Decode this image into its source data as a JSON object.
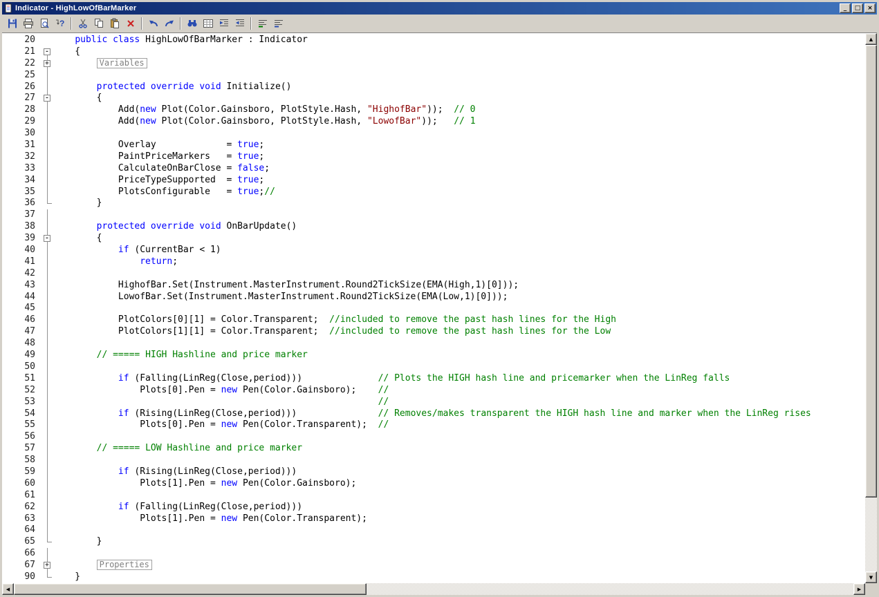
{
  "window": {
    "title": "Indicator - HighLowOfBarMarker",
    "titlebar_colors": [
      "#0a246a",
      "#3f74bd"
    ],
    "controls": {
      "minimize": "_",
      "maximize": "□",
      "close": "×"
    }
  },
  "toolbar": {
    "groups": [
      {
        "buttons": [
          {
            "name": "save"
          },
          {
            "name": "print"
          },
          {
            "name": "print-preview"
          },
          {
            "name": "context-help"
          }
        ]
      },
      {
        "buttons": [
          {
            "name": "cut"
          },
          {
            "name": "copy"
          },
          {
            "name": "paste"
          },
          {
            "name": "delete"
          }
        ]
      },
      {
        "buttons": [
          {
            "name": "undo"
          },
          {
            "name": "redo"
          }
        ]
      },
      {
        "buttons": [
          {
            "name": "find"
          },
          {
            "name": "goto-line"
          },
          {
            "name": "indent"
          },
          {
            "name": "outdent"
          }
        ]
      },
      {
        "buttons": [
          {
            "name": "comment"
          },
          {
            "name": "uncomment"
          }
        ]
      }
    ]
  },
  "editor": {
    "colors": {
      "keyword": "#0000ff",
      "comment": "#008000",
      "string": "#8b0000",
      "plain": "#000000",
      "region": "#808080",
      "line_number": "#202020"
    },
    "collapsed_regions": [
      "Variables",
      "Properties"
    ],
    "lines": [
      {
        "n": "20",
        "f": "",
        "s": [
          [
            "p",
            "    "
          ],
          [
            "k",
            "public"
          ],
          [
            "p",
            " "
          ],
          [
            "k",
            "class"
          ],
          [
            "p",
            " HighLowOfBarMarker : Indicator"
          ]
        ]
      },
      {
        "n": "21",
        "f": "open-first",
        "s": [
          [
            "p",
            "    {"
          ]
        ]
      },
      {
        "n": "22",
        "f": "closed",
        "s": [
          [
            "p",
            "        "
          ],
          [
            "g",
            "Variables"
          ]
        ]
      },
      {
        "n": "25",
        "f": "line",
        "s": []
      },
      {
        "n": "26",
        "f": "line",
        "s": [
          [
            "p",
            "        "
          ],
          [
            "k",
            "protected"
          ],
          [
            "p",
            " "
          ],
          [
            "k",
            "override"
          ],
          [
            "p",
            " "
          ],
          [
            "k",
            "void"
          ],
          [
            "p",
            " Initialize()"
          ]
        ]
      },
      {
        "n": "27",
        "f": "open",
        "s": [
          [
            "p",
            "        {"
          ]
        ]
      },
      {
        "n": "28",
        "f": "line",
        "s": [
          [
            "p",
            "            Add("
          ],
          [
            "k",
            "new"
          ],
          [
            "p",
            " Plot(Color.Gainsboro, PlotStyle.Hash, "
          ],
          [
            "s",
            "\"HighofBar\""
          ],
          [
            "p",
            "));  "
          ],
          [
            "c",
            "// 0"
          ]
        ]
      },
      {
        "n": "29",
        "f": "line",
        "s": [
          [
            "p",
            "            Add("
          ],
          [
            "k",
            "new"
          ],
          [
            "p",
            " Plot(Color.Gainsboro, PlotStyle.Hash, "
          ],
          [
            "s",
            "\"LowofBar\""
          ],
          [
            "p",
            "));   "
          ],
          [
            "c",
            "// 1"
          ]
        ]
      },
      {
        "n": "30",
        "f": "line",
        "s": []
      },
      {
        "n": "31",
        "f": "line",
        "s": [
          [
            "p",
            "            Overlay             = "
          ],
          [
            "k",
            "true"
          ],
          [
            "p",
            ";"
          ]
        ]
      },
      {
        "n": "32",
        "f": "line",
        "s": [
          [
            "p",
            "            PaintPriceMarkers   = "
          ],
          [
            "k",
            "true"
          ],
          [
            "p",
            ";"
          ]
        ]
      },
      {
        "n": "33",
        "f": "line",
        "s": [
          [
            "p",
            "            CalculateOnBarClose = "
          ],
          [
            "k",
            "false"
          ],
          [
            "p",
            ";"
          ]
        ]
      },
      {
        "n": "34",
        "f": "line",
        "s": [
          [
            "p",
            "            PriceTypeSupported  = "
          ],
          [
            "k",
            "true"
          ],
          [
            "p",
            ";"
          ]
        ]
      },
      {
        "n": "35",
        "f": "line",
        "s": [
          [
            "p",
            "            PlotsConfigurable   = "
          ],
          [
            "k",
            "true"
          ],
          [
            "p",
            ";"
          ],
          [
            "c",
            "//"
          ]
        ]
      },
      {
        "n": "36",
        "f": "end",
        "s": [
          [
            "p",
            "        }"
          ]
        ]
      },
      {
        "n": "37",
        "f": "line",
        "s": []
      },
      {
        "n": "38",
        "f": "line",
        "s": [
          [
            "p",
            "        "
          ],
          [
            "k",
            "protected"
          ],
          [
            "p",
            " "
          ],
          [
            "k",
            "override"
          ],
          [
            "p",
            " "
          ],
          [
            "k",
            "void"
          ],
          [
            "p",
            " OnBarUpdate()"
          ]
        ]
      },
      {
        "n": "39",
        "f": "open",
        "s": [
          [
            "p",
            "        {"
          ]
        ]
      },
      {
        "n": "40",
        "f": "line",
        "s": [
          [
            "p",
            "            "
          ],
          [
            "k",
            "if"
          ],
          [
            "p",
            " (CurrentBar < 1)"
          ]
        ]
      },
      {
        "n": "41",
        "f": "line",
        "s": [
          [
            "p",
            "                "
          ],
          [
            "k",
            "return"
          ],
          [
            "p",
            ";"
          ]
        ]
      },
      {
        "n": "42",
        "f": "line",
        "s": []
      },
      {
        "n": "43",
        "f": "line",
        "s": [
          [
            "p",
            "            HighofBar.Set(Instrument.MasterInstrument.Round2TickSize(EMA(High,1)[0]));"
          ]
        ]
      },
      {
        "n": "44",
        "f": "line",
        "s": [
          [
            "p",
            "            LowofBar.Set(Instrument.MasterInstrument.Round2TickSize(EMA(Low,1)[0]));"
          ]
        ]
      },
      {
        "n": "45",
        "f": "line",
        "s": []
      },
      {
        "n": "46",
        "f": "line",
        "s": [
          [
            "p",
            "            PlotColors[0][1] = Color.Transparent;  "
          ],
          [
            "c",
            "//included to remove the past hash lines for the High"
          ]
        ]
      },
      {
        "n": "47",
        "f": "line",
        "s": [
          [
            "p",
            "            PlotColors[1][1] = Color.Transparent;  "
          ],
          [
            "c",
            "//included to remove the past hash lines for the Low"
          ]
        ]
      },
      {
        "n": "48",
        "f": "line",
        "s": []
      },
      {
        "n": "49",
        "f": "line",
        "s": [
          [
            "p",
            "        "
          ],
          [
            "c",
            "// ===== HIGH Hashline and price marker"
          ]
        ]
      },
      {
        "n": "50",
        "f": "line",
        "s": []
      },
      {
        "n": "51",
        "f": "line",
        "s": [
          [
            "p",
            "            "
          ],
          [
            "k",
            "if"
          ],
          [
            "p",
            " (Falling(LinReg(Close,period)))              "
          ],
          [
            "c",
            "// Plots the HIGH hash line and pricemarker when the LinReg falls"
          ]
        ]
      },
      {
        "n": "52",
        "f": "line",
        "s": [
          [
            "p",
            "                Plots[0].Pen = "
          ],
          [
            "k",
            "new"
          ],
          [
            "p",
            " Pen(Color.Gainsboro);    "
          ],
          [
            "c",
            "//"
          ]
        ]
      },
      {
        "n": "53",
        "f": "line",
        "s": [
          [
            "p",
            "                                                            "
          ],
          [
            "c",
            "//"
          ]
        ]
      },
      {
        "n": "54",
        "f": "line",
        "s": [
          [
            "p",
            "            "
          ],
          [
            "k",
            "if"
          ],
          [
            "p",
            " (Rising(LinReg(Close,period)))               "
          ],
          [
            "c",
            "// Removes/makes transparent the HIGH hash line and marker when the LinReg rises"
          ]
        ]
      },
      {
        "n": "55",
        "f": "line",
        "s": [
          [
            "p",
            "                Plots[0].Pen = "
          ],
          [
            "k",
            "new"
          ],
          [
            "p",
            " Pen(Color.Transparent);  "
          ],
          [
            "c",
            "//"
          ]
        ]
      },
      {
        "n": "56",
        "f": "line",
        "s": []
      },
      {
        "n": "57",
        "f": "line",
        "s": [
          [
            "p",
            "        "
          ],
          [
            "c",
            "// ===== LOW Hashline and price marker"
          ]
        ]
      },
      {
        "n": "58",
        "f": "line",
        "s": []
      },
      {
        "n": "59",
        "f": "line",
        "s": [
          [
            "p",
            "            "
          ],
          [
            "k",
            "if"
          ],
          [
            "p",
            " (Rising(LinReg(Close,period)))"
          ]
        ]
      },
      {
        "n": "60",
        "f": "line",
        "s": [
          [
            "p",
            "                Plots[1].Pen = "
          ],
          [
            "k",
            "new"
          ],
          [
            "p",
            " Pen(Color.Gainsboro);"
          ]
        ]
      },
      {
        "n": "61",
        "f": "line",
        "s": []
      },
      {
        "n": "62",
        "f": "line",
        "s": [
          [
            "p",
            "            "
          ],
          [
            "k",
            "if"
          ],
          [
            "p",
            " (Falling(LinReg(Close,period)))"
          ]
        ]
      },
      {
        "n": "63",
        "f": "line",
        "s": [
          [
            "p",
            "                Plots[1].Pen = "
          ],
          [
            "k",
            "new"
          ],
          [
            "p",
            " Pen(Color.Transparent);"
          ]
        ]
      },
      {
        "n": "64",
        "f": "line",
        "s": []
      },
      {
        "n": "65",
        "f": "end",
        "s": [
          [
            "p",
            "        }"
          ]
        ]
      },
      {
        "n": "66",
        "f": "line",
        "s": []
      },
      {
        "n": "67",
        "f": "closed",
        "s": [
          [
            "p",
            "        "
          ],
          [
            "g",
            "Properties"
          ]
        ]
      },
      {
        "n": "90",
        "f": "end",
        "s": [
          [
            "p",
            "    }"
          ]
        ]
      }
    ]
  },
  "scrollbars": {
    "up_arrow": "▲",
    "down_arrow": "▼",
    "left_arrow": "◀",
    "right_arrow": "▶"
  }
}
